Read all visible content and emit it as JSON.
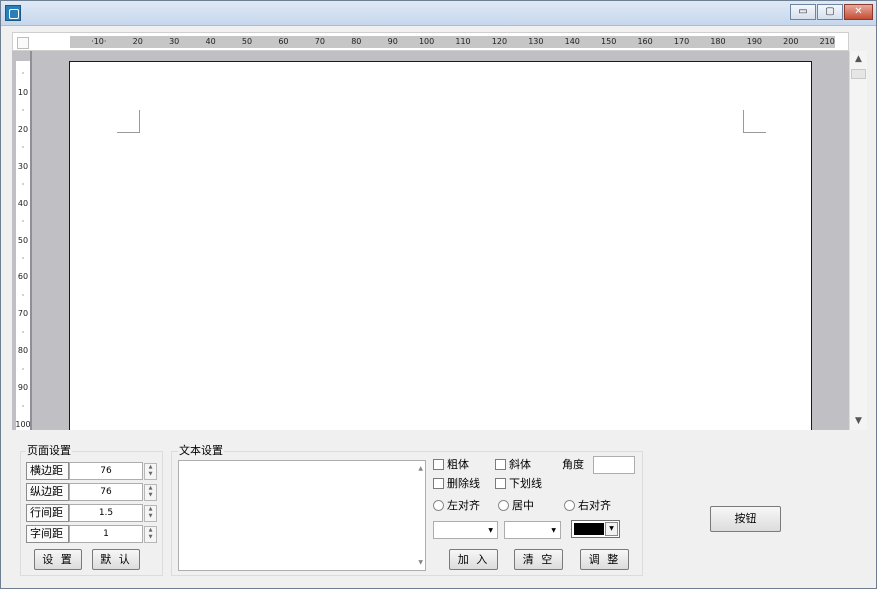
{
  "window": {
    "title": ""
  },
  "caption_buttons": {
    "minimize": "▭",
    "maximize": "▢",
    "close": "✕"
  },
  "ruler_h": {
    "ticks": [
      "·10·",
      "20",
      "30",
      "40",
      "50",
      "60",
      "70",
      "80",
      "90",
      "100",
      "110",
      "120",
      "130",
      "140",
      "150",
      "160",
      "170",
      "180",
      "190",
      "200",
      "210"
    ]
  },
  "ruler_v": {
    "ticks": [
      "·",
      "10",
      "·",
      "20",
      "·",
      "30",
      "·",
      "40",
      "·",
      "50",
      "·",
      "60",
      "·",
      "70",
      "·",
      "80",
      "·",
      "90",
      "·",
      "100"
    ]
  },
  "page_setup": {
    "title": "页面设置",
    "rows": [
      {
        "label": "横边距",
        "value": "76"
      },
      {
        "label": "纵边距",
        "value": "76"
      },
      {
        "label": "行间距",
        "value": "1.5"
      },
      {
        "label": "字间距",
        "value": "1"
      }
    ],
    "set_button": "设 置",
    "default_button": "默 认"
  },
  "text_setup": {
    "title": "文本设置",
    "bold": "粗体",
    "italic": "斜体",
    "angle_label": "角度",
    "angle_value": "",
    "strikethrough": "删除线",
    "underline": "下划线",
    "align_left": "左对齐",
    "align_center": "居中",
    "align_right": "右对齐",
    "font_value": "",
    "size_value": "",
    "text_color": "#000000",
    "add_button": "加 入",
    "clear_button": "清 空",
    "adjust_button": "调 整"
  },
  "extra_button": "按钮"
}
